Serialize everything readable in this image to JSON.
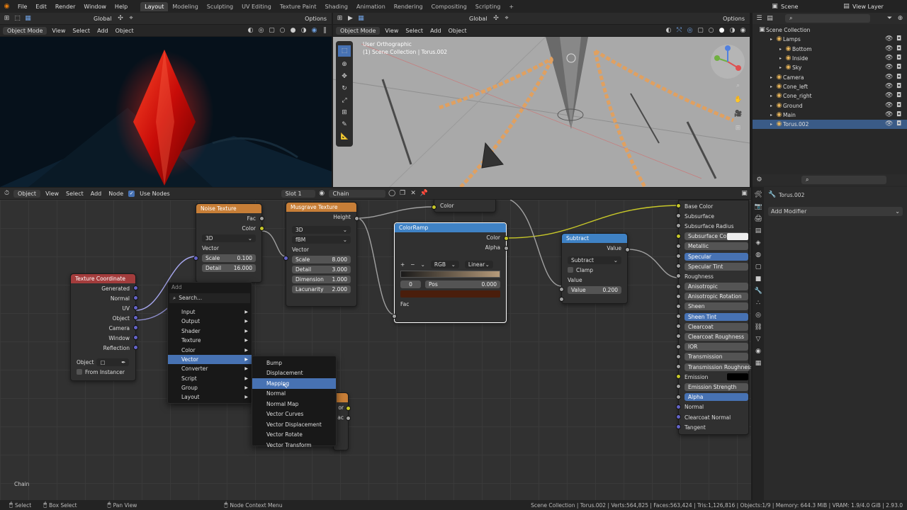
{
  "menu": {
    "items": [
      "File",
      "Edit",
      "Render",
      "Window",
      "Help"
    ]
  },
  "workspaces": {
    "tabs": [
      "Layout",
      "Modeling",
      "Sculpting",
      "UV Editing",
      "Texture Paint",
      "Shading",
      "Animation",
      "Rendering",
      "Compositing",
      "Scripting"
    ]
  },
  "top_right": {
    "scene": "Scene",
    "view_layer": "View Layer"
  },
  "viewport_left": {
    "mode": "Object Mode",
    "menus": [
      "View",
      "Select",
      "Add",
      "Object"
    ],
    "transform": "Global",
    "options": "Options"
  },
  "viewport_right": {
    "mode": "Object Mode",
    "menus": [
      "View",
      "Select",
      "Add",
      "Object"
    ],
    "transform": "Global",
    "options": "Options",
    "view_name": "User Orthographic",
    "collection_info": "(1) Scene Collection | Torus.002"
  },
  "outliner": {
    "title": "Scene Collection",
    "items": [
      {
        "label": "Lamps",
        "depth": 1,
        "color": "#e8b55a"
      },
      {
        "label": "Bottom",
        "depth": 2,
        "color": "#e8b55a"
      },
      {
        "label": "Inside",
        "depth": 2,
        "color": "#e8b55a"
      },
      {
        "label": "Sky",
        "depth": 2,
        "color": "#e8b55a"
      },
      {
        "label": "Camera",
        "depth": 1,
        "color": "#e8b55a"
      },
      {
        "label": "Cone_left",
        "depth": 1,
        "color": "#e8b55a"
      },
      {
        "label": "Cone_right",
        "depth": 1,
        "color": "#e8b55a"
      },
      {
        "label": "Ground",
        "depth": 1,
        "color": "#e8b55a"
      },
      {
        "label": "Main",
        "depth": 1,
        "color": "#e8b55a"
      },
      {
        "label": "Torus.002",
        "depth": 1,
        "color": "#e8b55a",
        "selected": true
      }
    ]
  },
  "properties": {
    "object": "Torus.002",
    "add_modifier": "Add Modifier"
  },
  "node_header": {
    "mode": "Object",
    "menus": [
      "View",
      "Select",
      "Add",
      "Node"
    ],
    "use_nodes": "Use Nodes",
    "slot": "Slot 1",
    "material": "Chain"
  },
  "nodes": {
    "noise": {
      "title": "Noise Texture",
      "out_fac": "Fac",
      "out_color": "Color",
      "dim": "3D",
      "in_vector": "Vector",
      "scale_label": "Scale",
      "scale_value": "0.100",
      "detail_label": "Detail",
      "detail_value": "16.000"
    },
    "musgrave": {
      "title": "Musgrave Texture",
      "out_height": "Height",
      "dim": "3D",
      "type": "fBM",
      "in_vector": "Vector",
      "scale_label": "Scale",
      "scale_value": "8.000",
      "detail_label": "Detail",
      "detail_value": "3.000",
      "dimension_label": "Dimension",
      "dimension_value": "1.000",
      "lacunarity_label": "Lacunarity",
      "lacunarity_value": "2.000"
    },
    "color_top": {
      "out_color": "Color"
    },
    "colorramp": {
      "title": "ColorRamp",
      "out_color": "Color",
      "out_alpha": "Alpha",
      "plus": "+",
      "minus": "−",
      "mode": "RGB",
      "interp": "Linear",
      "index": "0",
      "pos_label": "Pos",
      "pos_value": "0.000",
      "in_fac": "Fac"
    },
    "subtract": {
      "title": "Subtract",
      "out_value": "Value",
      "op": "Subtract",
      "clamp": "Clamp",
      "in_value": "Value",
      "value_label": "Value",
      "value_value": "0.200"
    },
    "texcoord": {
      "title": "Texture Coordinate",
      "outputs": [
        "Generated",
        "Normal",
        "UV",
        "Object",
        "Camera",
        "Window",
        "Reflection"
      ],
      "object_label": "Object",
      "from_instancer": "From Instancer"
    },
    "bsdf": {
      "rows": [
        "Base Color",
        "Subsurface",
        "Subsurface Radius",
        "Subsurface Color",
        "Metallic",
        "Specular",
        "Specular Tint",
        "Roughness",
        "Anisotropic",
        "Anisotropic Rotation",
        "Sheen",
        "Sheen Tint",
        "Clearcoat",
        "Clearcoat Roughness",
        "IOR",
        "Transmission",
        "Transmission Roughness",
        "Emission",
        "Emission Strength",
        "Alpha",
        "Normal",
        "Clearcoat Normal",
        "Tangent"
      ]
    },
    "hidden_node": {
      "frag1": "or",
      "frag2": "ac"
    }
  },
  "add_menu": {
    "title": "Add",
    "search": "Search...",
    "items": [
      "Input",
      "Output",
      "Shader",
      "Texture",
      "Color",
      "Vector",
      "Converter",
      "Script",
      "Group",
      "Layout"
    ],
    "highlight_index": 5
  },
  "vector_submenu": {
    "items": [
      "Bump",
      "Displacement",
      "Mapping",
      "Normal",
      "Normal Map",
      "Vector Curves",
      "Vector Displacement",
      "Vector Rotate",
      "Vector Transform"
    ],
    "highlight_index": 2
  },
  "editor_footer_label": "Chain",
  "status": {
    "select": "Select",
    "box_select": "Box Select",
    "pan_view": "Pan View",
    "context_menu": "Node Context Menu",
    "info": "Scene Collection | Torus.002 | Verts:564,825 | Faces:563,424 | Tris:1,126,816 | Objects:1/9 | Memory: 644.3 MiB | VRAM: 1.9/4.0 GiB | 2.93.0"
  }
}
